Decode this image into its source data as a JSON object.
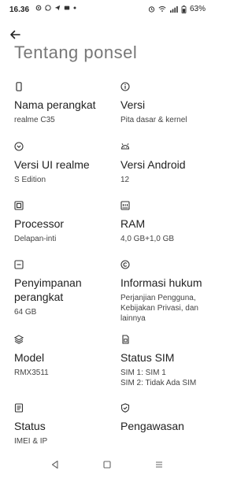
{
  "status_bar": {
    "time": "16.36",
    "battery": "63%"
  },
  "page": {
    "title": "Tentang ponsel"
  },
  "items": [
    {
      "label": "Nama perangkat",
      "value": "realme C35",
      "icon": "phone-icon"
    },
    {
      "label": "Versi",
      "value": "Pita dasar & kernel",
      "icon": "info-icon"
    },
    {
      "label": "Versi UI realme",
      "value": "S Edition",
      "icon": "chevron-circle-icon"
    },
    {
      "label": "Versi Android",
      "value": "12",
      "icon": "android-icon"
    },
    {
      "label": "Processor",
      "value": "Delapan-inti",
      "icon": "chip-icon"
    },
    {
      "label": "RAM",
      "value": "4,0 GB+1,0 GB",
      "icon": "ram-icon"
    },
    {
      "label": "Penyimpanan perangkat",
      "value": "64 GB",
      "icon": "storage-icon"
    },
    {
      "label": "Informasi hukum",
      "value": "Perjanjian Pengguna, Kebijakan Privasi, dan lainnya",
      "icon": "copyright-icon"
    },
    {
      "label": "Model",
      "value": "RMX3511",
      "icon": "layers-icon"
    },
    {
      "label": "Status SIM",
      "value": "SIM 1: SIM 1",
      "value2": "SIM 2: Tidak Ada SIM",
      "icon": "sim-icon"
    },
    {
      "label": "Status",
      "value": "IMEI & IP",
      "icon": "document-icon"
    },
    {
      "label": "Pengawasan",
      "value": "",
      "icon": "shield-icon"
    }
  ]
}
